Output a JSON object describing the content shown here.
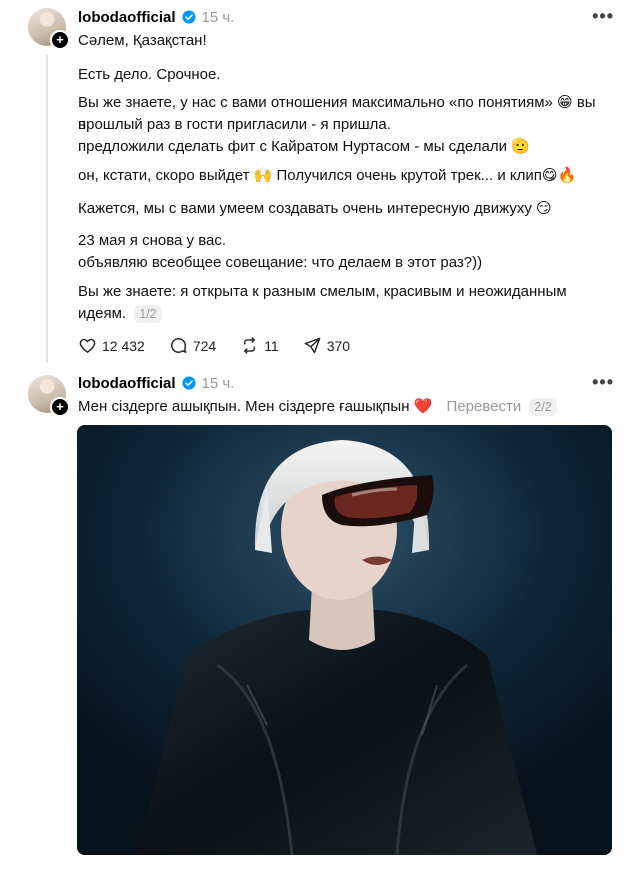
{
  "post1": {
    "username": "lobodaofficial",
    "time": "15 ч.",
    "more": "•••",
    "lines": [
      "Сәлем, Қазақстан!",
      "Есть дело. Срочное.",
      "Вы же знаете, у нас с вами отношения максимально «по понятиям» 😁 вы в",
      "прошлый раз в гости пригласили - я пришла.",
      "предложили сделать фит с Кайратом Нуртасом - мы сделали 🫡",
      "он, кстати, скоро выйдет 🙌 Получился очень крутой трек... и клип😋🔥",
      "Кажется, мы с вами умеем создавать очень интересную движуху 😏",
      "23 мая я снова у вас.",
      "объявляю всеобщее совещание: что делаем в этот раз?))",
      "Вы же знаете: я открыта к разным смелым, красивым и неожиданным",
      "идеям."
    ],
    "counter": "1/2",
    "likes": "12 432",
    "comments": "724",
    "reposts": "11",
    "shares": "370"
  },
  "post2": {
    "username": "lobodaofficial",
    "time": "15 ч.",
    "more": "•••",
    "text": "Мен сіздерге ашықпын. Мен сіздерге ғашықпын ❤️",
    "translate": "Перевести",
    "counter": "2/2"
  },
  "icons": {
    "verified_color": "#0095f6",
    "like": "heart-icon",
    "comment": "comment-icon",
    "repost": "repost-icon",
    "share": "share-icon"
  }
}
